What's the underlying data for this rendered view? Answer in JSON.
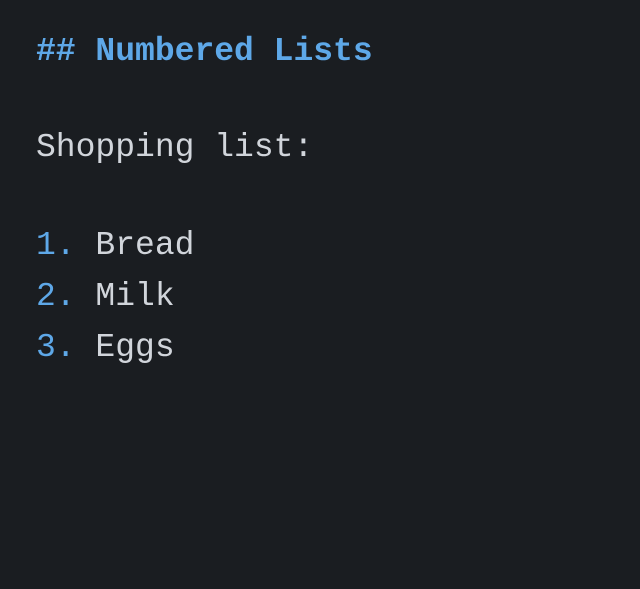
{
  "heading": {
    "marker": "##",
    "text": "Numbered Lists"
  },
  "intro": "Shopping list:",
  "items": [
    {
      "marker": "1.",
      "text": "Bread"
    },
    {
      "marker": "2.",
      "text": "Milk"
    },
    {
      "marker": "3.",
      "text": "Eggs"
    }
  ]
}
